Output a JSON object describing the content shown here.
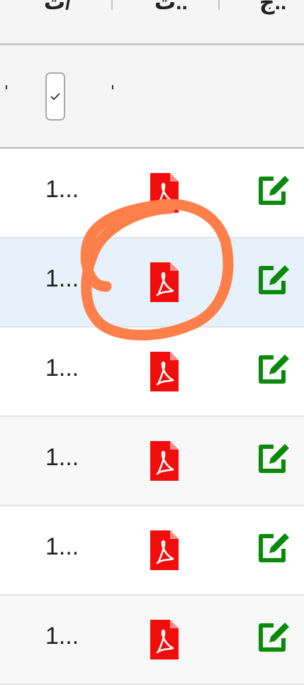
{
  "header": {
    "col1": "ت/",
    "col2": "ت..",
    "col3": "ج.."
  },
  "rows": [
    {
      "num": "1...",
      "pdf_icon": "pdf-file-icon",
      "edit_icon": "edit-icon"
    },
    {
      "num": "1...",
      "pdf_icon": "pdf-file-icon",
      "edit_icon": "edit-icon"
    },
    {
      "num": "1...",
      "pdf_icon": "pdf-file-icon",
      "edit_icon": "edit-icon"
    },
    {
      "num": "1...",
      "pdf_icon": "pdf-file-icon",
      "edit_icon": "edit-icon"
    },
    {
      "num": "1...",
      "pdf_icon": "pdf-file-icon",
      "edit_icon": "edit-icon"
    },
    {
      "num": "1...",
      "pdf_icon": "pdf-file-icon",
      "edit_icon": "edit-icon"
    }
  ],
  "colors": {
    "pdf": "#f20d0d",
    "edit": "#0a8a0a",
    "highlight_row": "#e7f1fb",
    "annotation": "#ff7f4a"
  }
}
